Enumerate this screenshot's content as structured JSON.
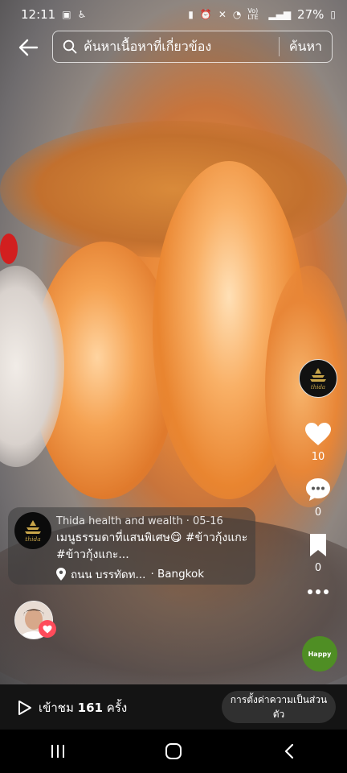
{
  "status_bar": {
    "time": "12:11",
    "network": "Vo) LTE",
    "battery": "27%"
  },
  "search": {
    "placeholder": "ค้นหาเนื้อหาที่เกี่ยวข้อง",
    "button_label": "ค้นหา"
  },
  "post": {
    "author": "Thida health and wealth",
    "date": "05-16",
    "caption": "เมนูธรรมดาที่แสนพิเศษ😋 #ข้าวกุ้งแกะ #ข้าวกุ้งแกะ...",
    "location": "ถนน บรรทัดท...",
    "city": "· Bangkok",
    "avatar_text": "thida"
  },
  "actions": {
    "likes": "10",
    "comments": "0",
    "saves": "0"
  },
  "music": {
    "label": "Happy"
  },
  "bottom": {
    "views_prefix": "เข้าชม",
    "views_count": "161",
    "views_suffix": "ครั้ง",
    "privacy_button": "การตั้งค่าความเป็นส่วนตัว"
  },
  "colors": {
    "accent_like": "#ff4b5a",
    "music_disc": "#4f8e24"
  }
}
